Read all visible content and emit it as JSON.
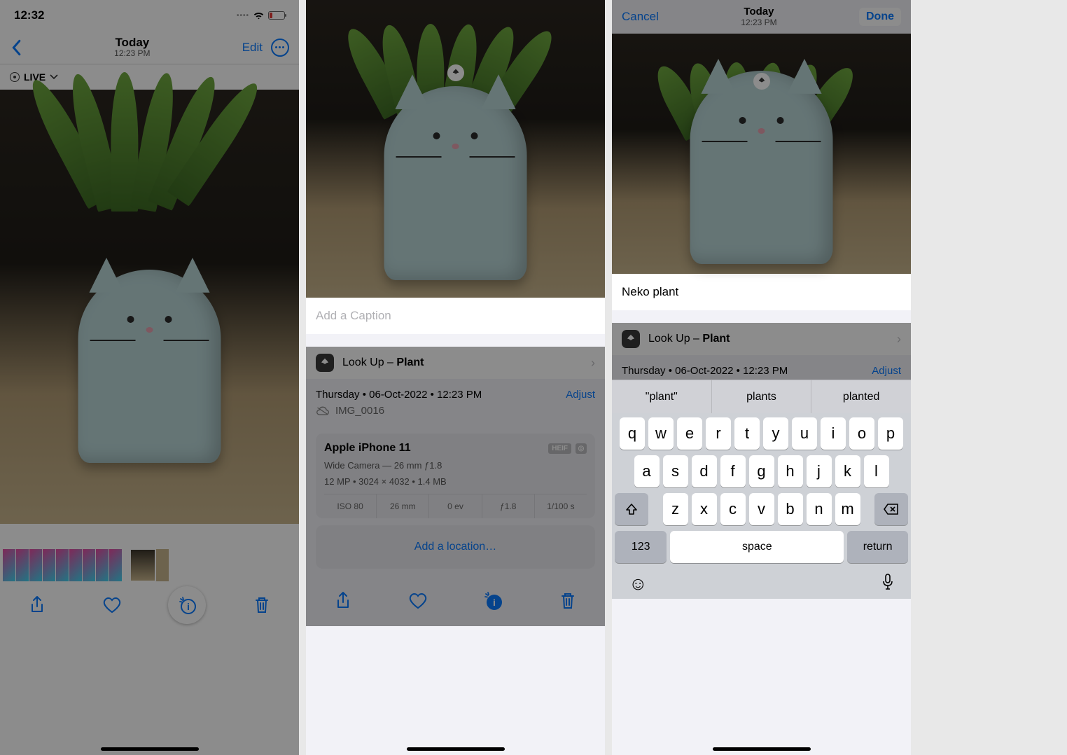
{
  "screen1": {
    "status_time": "12:32",
    "nav_title": "Today",
    "nav_sub": "12:23 PM",
    "edit_label": "Edit",
    "live_label": "LIVE"
  },
  "screen2": {
    "caption_placeholder": "Add a Caption",
    "lookup_prefix": "Look Up – ",
    "lookup_subject": "Plant",
    "meta_date": "Thursday • 06-Oct-2022 • 12:23 PM",
    "adjust_label": "Adjust",
    "filename": "IMG_0016",
    "device": "Apple iPhone 11",
    "badge1": "HEIF",
    "lens_line": "Wide Camera — 26 mm ƒ1.8",
    "res_line": "12 MP • 3024 × 4032 • 1.4 MB",
    "exif": {
      "iso": "ISO 80",
      "focal": "26 mm",
      "ev": "0 ev",
      "aperture": "ƒ1.8",
      "shutter": "1/100 s"
    },
    "add_location": "Add a location…"
  },
  "screen3": {
    "cancel_label": "Cancel",
    "nav_title": "Today",
    "nav_sub": "12:23 PM",
    "done_label": "Done",
    "caption_value": "Neko plant",
    "lookup_prefix": "Look Up – ",
    "lookup_subject": "Plant",
    "meta_date": "Thursday • 06-Oct-2022 • 12:23 PM",
    "adjust_label": "Adjust",
    "suggestions": [
      "\"plant\"",
      "plants",
      "planted"
    ],
    "keys_r1": [
      "q",
      "w",
      "e",
      "r",
      "t",
      "y",
      "u",
      "i",
      "o",
      "p"
    ],
    "keys_r2": [
      "a",
      "s",
      "d",
      "f",
      "g",
      "h",
      "j",
      "k",
      "l"
    ],
    "keys_r3": [
      "z",
      "x",
      "c",
      "v",
      "b",
      "n",
      "m"
    ],
    "key_num": "123",
    "key_space": "space",
    "key_return": "return"
  }
}
